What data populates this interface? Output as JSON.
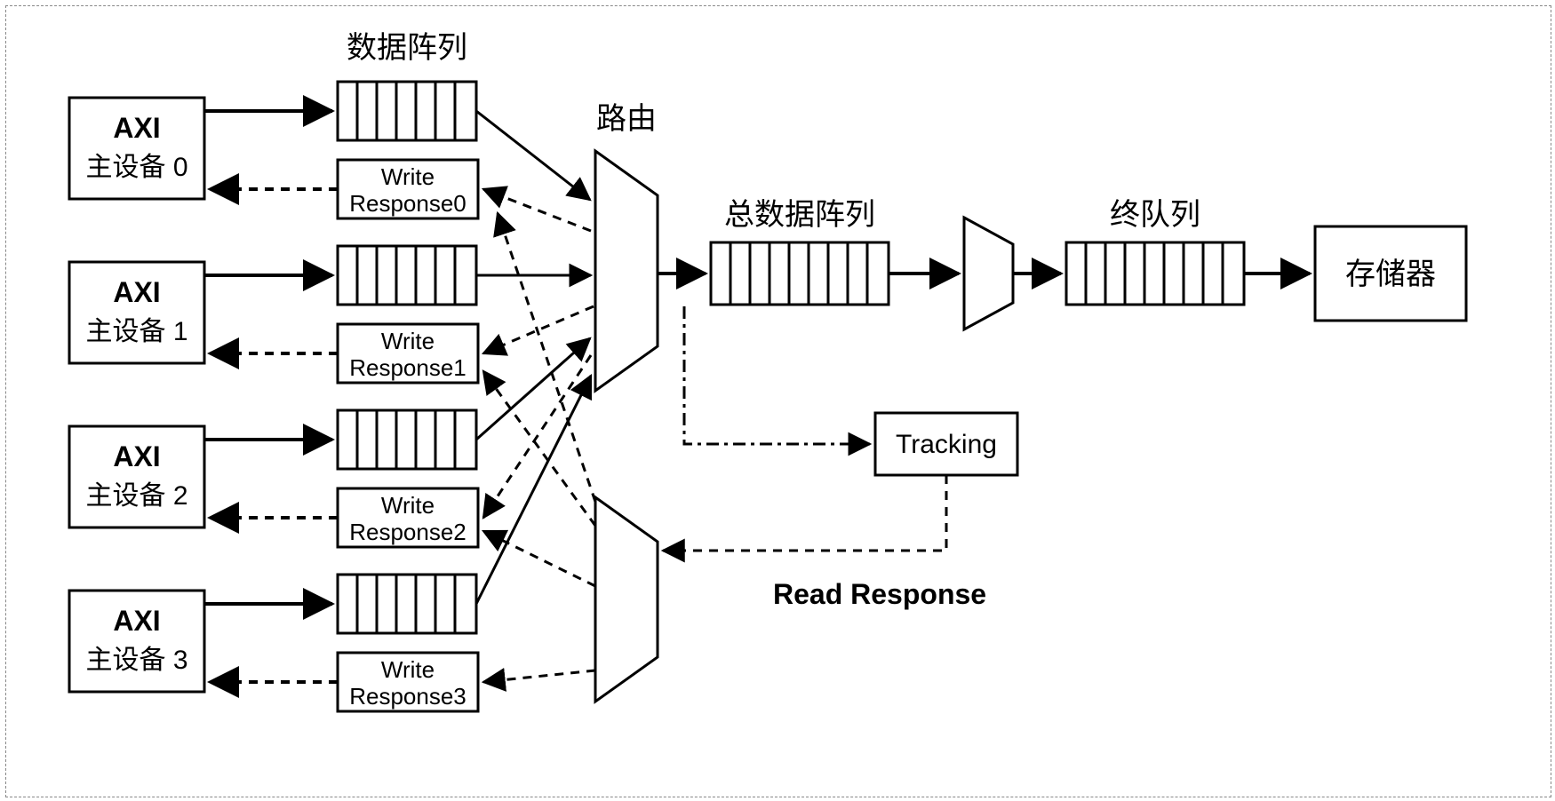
{
  "labels": {
    "data_array": "数据阵列",
    "router": "路由",
    "total_data_array": "总数据阵列",
    "final_queue": "终队列",
    "memory": "存储器",
    "tracking": "Tracking",
    "read_response": "Read Response"
  },
  "masters": [
    {
      "line1": "AXI",
      "line2": "主设备 0"
    },
    {
      "line1": "AXI",
      "line2": "主设备 1"
    },
    {
      "line1": "AXI",
      "line2": "主设备 2"
    },
    {
      "line1": "AXI",
      "line2": "主设备 3"
    }
  ],
  "write_responses": [
    {
      "line1": "Write",
      "line2": "Response0"
    },
    {
      "line1": "Write",
      "line2": "Response1"
    },
    {
      "line1": "Write",
      "line2": "Response2"
    },
    {
      "line1": "Write",
      "line2": "Response3"
    }
  ]
}
